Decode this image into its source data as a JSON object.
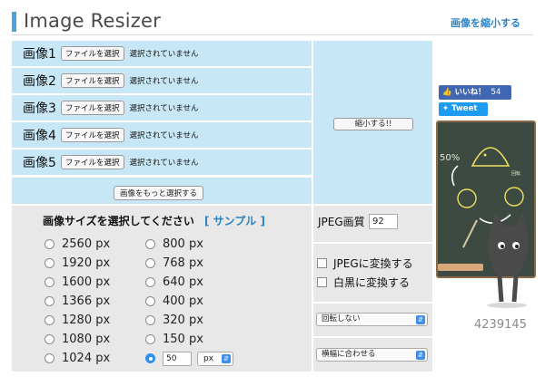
{
  "header": {
    "title": "Image Resizer",
    "shrink_link": "画像を縮小する"
  },
  "upload": {
    "rows": [
      {
        "label": "画像1",
        "button": "ファイルを選択",
        "status": "選択されていません"
      },
      {
        "label": "画像2",
        "button": "ファイルを選択",
        "status": "選択されていません"
      },
      {
        "label": "画像3",
        "button": "ファイルを選択",
        "status": "選択されていません"
      },
      {
        "label": "画像4",
        "button": "ファイルを選択",
        "status": "選択されていません"
      },
      {
        "label": "画像5",
        "button": "ファイルを選択",
        "status": "選択されていません"
      }
    ],
    "more_button": "画像をもっと選択する",
    "shrink_button": "縮小する!!"
  },
  "sizes": {
    "heading": "画像サイズを選択してください",
    "sample_link": "[ サンプル ]",
    "left": [
      "2560 px",
      "1920 px",
      "1600 px",
      "1366 px",
      "1280 px",
      "1080 px",
      "1024 px"
    ],
    "right": [
      "800 px",
      "768 px",
      "640 px",
      "400 px",
      "320 px",
      "150 px"
    ],
    "custom_value": "50",
    "unit": "px",
    "selected": "custom"
  },
  "options": {
    "jpeg_quality_label": "JPEG画質",
    "jpeg_quality_value": "92",
    "convert_jpeg": "JPEGに変換する",
    "convert_bw": "白黒に変換する",
    "rotate_select": "回転しない",
    "fit_select": "横幅に合わせる"
  },
  "social": {
    "like_label": "いいね！",
    "like_count": "54",
    "tweet_label": "Tweet"
  },
  "illustration": {
    "board_text": "50%",
    "board_small_text": "回転"
  },
  "counter": "4239145",
  "colors": {
    "accent": "#4aa3df",
    "panel_blue": "#c8e7f6",
    "panel_gray": "#e8e8e8",
    "facebook": "#4267b2",
    "twitter": "#1d9bf0",
    "board": "#3c4a42"
  }
}
